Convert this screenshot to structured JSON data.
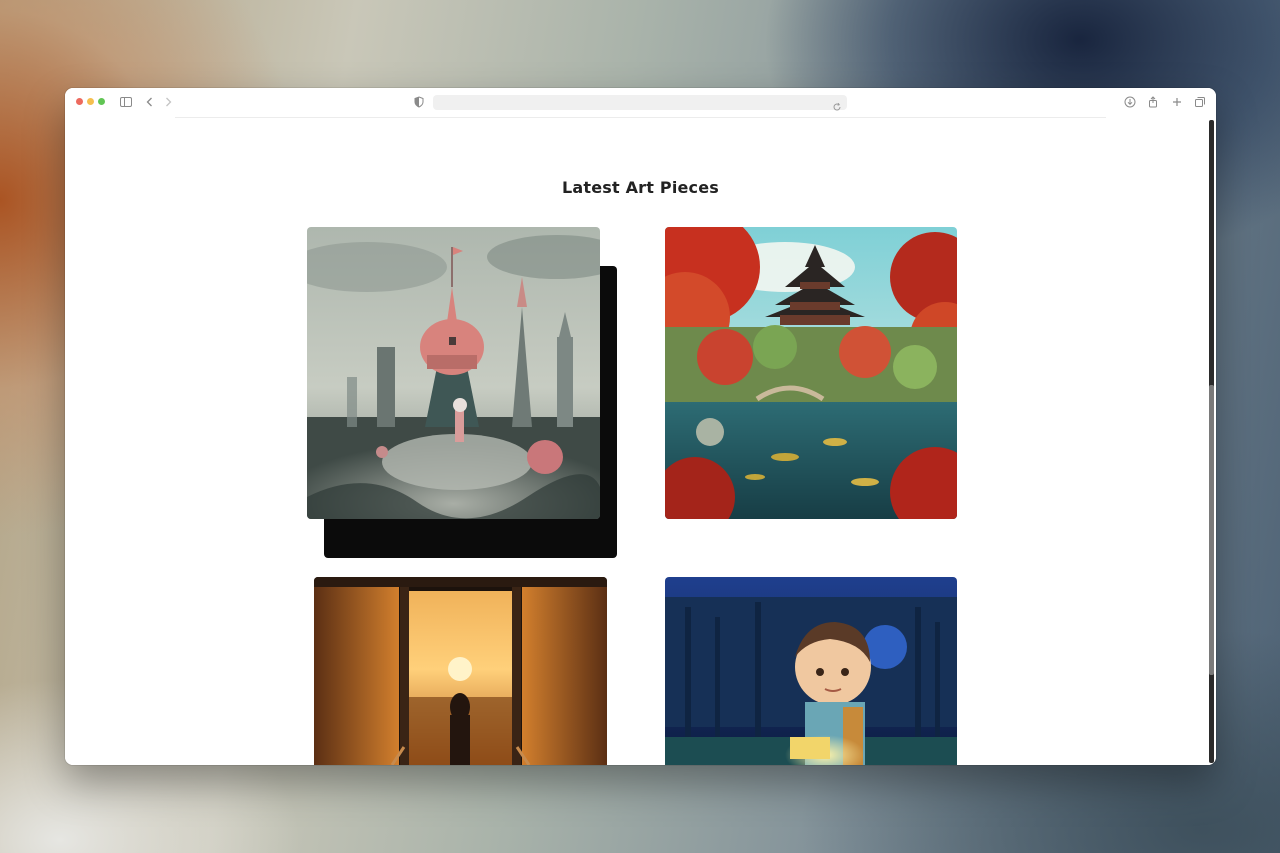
{
  "browser": {
    "address_bar_value": ""
  },
  "page": {
    "title": "Latest Art Pieces"
  },
  "gallery": {
    "items": [
      {
        "name": "whimsical-castle-painting"
      },
      {
        "name": "japanese-pagoda-garden-painting"
      },
      {
        "name": "sunset-elevator-painting"
      },
      {
        "name": "boy-with-glowing-book-painting"
      }
    ]
  },
  "colors": {
    "background_window": "#ffffff",
    "title_text": "#222222",
    "traffic_red": "#ed6a5e",
    "traffic_yellow": "#f5bf4f",
    "traffic_green": "#61c554"
  },
  "icons": {
    "sidebar": "sidebar-icon",
    "back": "chevron-left-icon",
    "forward": "chevron-right-icon",
    "privacy": "shield-icon",
    "reload": "reload-icon",
    "download": "download-icon",
    "share": "share-icon",
    "new_tab": "plus-icon",
    "tabs": "tabs-overview-icon"
  }
}
